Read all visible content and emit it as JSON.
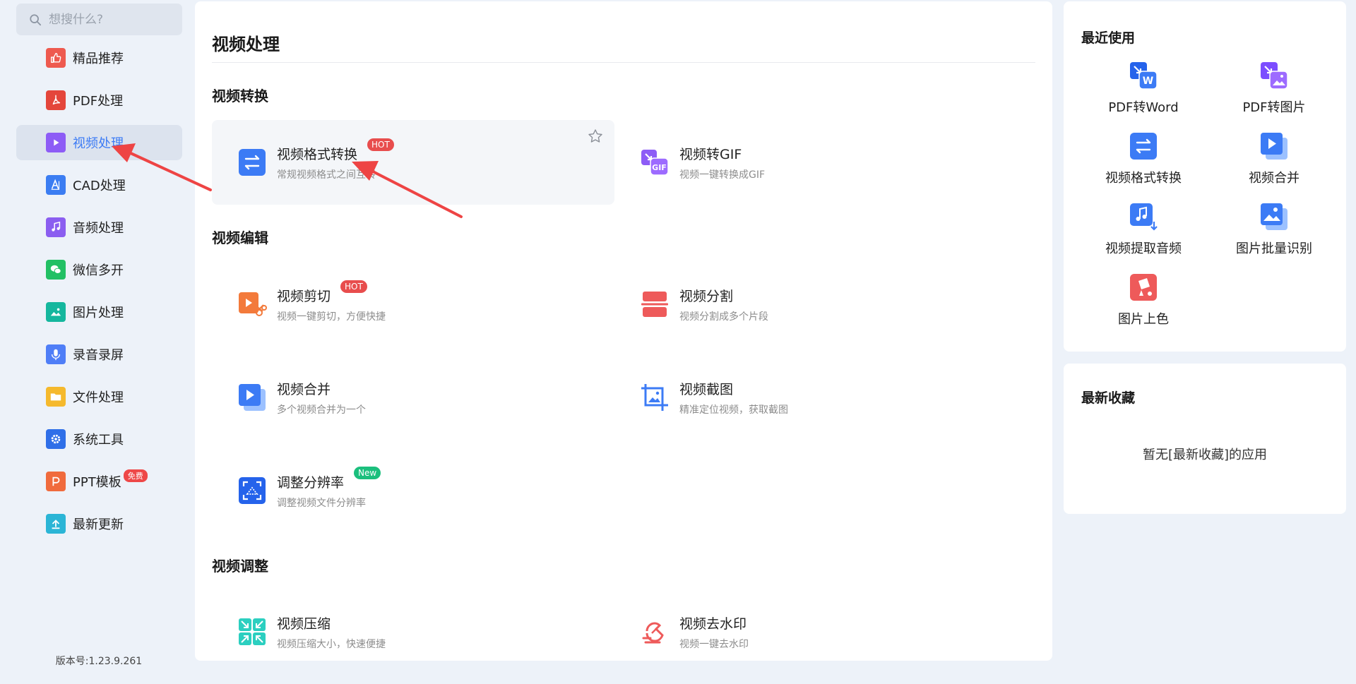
{
  "sidebar": {
    "search_placeholder": "想搜什么?",
    "items": [
      {
        "label": "精品推荐",
        "icon": "thumbs-up-icon",
        "color": "#ee5a4f"
      },
      {
        "label": "PDF处理",
        "icon": "pdf-icon",
        "color": "#e4463b"
      },
      {
        "label": "视频处理",
        "icon": "video-play-icon",
        "color": "#8d5cf6",
        "active": true
      },
      {
        "label": "CAD处理",
        "icon": "cad-icon",
        "color": "#3b7df2"
      },
      {
        "label": "音频处理",
        "icon": "music-note-icon",
        "color": "#8b5ef0"
      },
      {
        "label": "微信多开",
        "icon": "wechat-icon",
        "color": "#22c064"
      },
      {
        "label": "图片处理",
        "icon": "image-icon",
        "color": "#15b79e"
      },
      {
        "label": "录音录屏",
        "icon": "microphone-icon",
        "color": "#4f7ef7"
      },
      {
        "label": "文件处理",
        "icon": "folder-icon",
        "color": "#f5b92d"
      },
      {
        "label": "系统工具",
        "icon": "gear-icon",
        "color": "#2f6fe8"
      },
      {
        "label": "PPT模板",
        "icon": "ppt-icon",
        "color": "#f06b3d",
        "badge": "免费"
      },
      {
        "label": "最新更新",
        "icon": "upload-icon",
        "color": "#2bb5d6"
      }
    ],
    "version": "版本号:1.23.9.261"
  },
  "main": {
    "title": "视频处理",
    "sections": [
      {
        "title": "视频转换"
      },
      {
        "title": "视频编辑"
      },
      {
        "title": "视频调整"
      }
    ],
    "cards": [
      {
        "title": "视频格式转换",
        "subtitle": "常规视频格式之间互转",
        "badge": "HOT",
        "icon": "convert-arrows-icon"
      },
      {
        "title": "视频转GIF",
        "subtitle": "视频一键转换成GIF",
        "icon": "gif-icon"
      },
      {
        "title": "视频剪切",
        "subtitle": "视频一键剪切，方便快捷",
        "badge": "HOT",
        "icon": "video-cut-icon"
      },
      {
        "title": "视频分割",
        "subtitle": "视频分割成多个片段",
        "icon": "split-icon"
      },
      {
        "title": "视频合并",
        "subtitle": "多个视频合并为一个",
        "icon": "video-merge-icon"
      },
      {
        "title": "视频截图",
        "subtitle": "精准定位视频，获取截图",
        "icon": "crop-screenshot-icon"
      },
      {
        "title": "调整分辨率",
        "subtitle": "调整视频文件分辨率",
        "badge": "New",
        "icon": "resolution-icon"
      },
      {
        "title": "视频压缩",
        "subtitle": "视频压缩大小，快速便捷",
        "icon": "compress-icon"
      },
      {
        "title": "视频去水印",
        "subtitle": "视频一键去水印",
        "icon": "watermark-remove-icon"
      }
    ]
  },
  "recent": {
    "title": "最近使用",
    "items": [
      {
        "label": "PDF转Word",
        "icon": "pdf-to-word-icon"
      },
      {
        "label": "PDF转图片",
        "icon": "pdf-to-image-icon"
      },
      {
        "label": "视频格式转换",
        "icon": "convert-arrows-icon"
      },
      {
        "label": "视频合并",
        "icon": "video-merge-icon"
      },
      {
        "label": "视频提取音频",
        "icon": "extract-audio-icon"
      },
      {
        "label": "图片批量识别",
        "icon": "image-recognize-icon"
      },
      {
        "label": "图片上色",
        "icon": "colorize-icon"
      }
    ]
  },
  "favorites": {
    "title": "最新收藏",
    "empty_text": "暂无[最新收藏]的应用"
  },
  "colors": {
    "accent": "#3c7bf5",
    "hot": "#e84d4d",
    "new": "#1bbf7d",
    "arrow": "#ee4444"
  }
}
